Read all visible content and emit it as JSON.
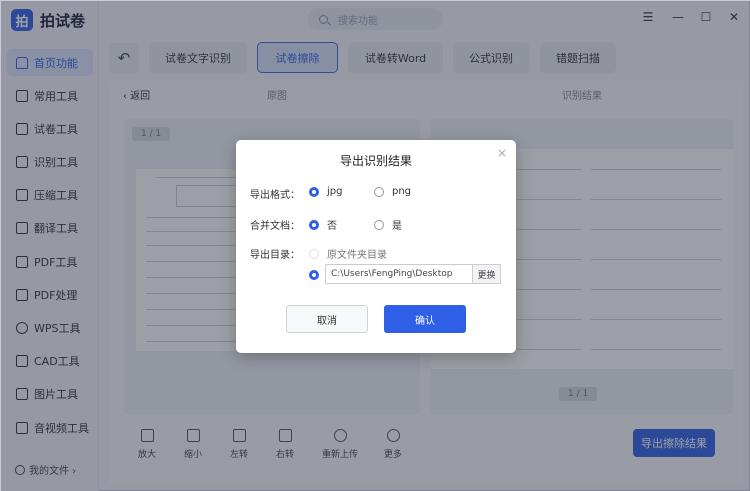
{
  "app": {
    "logo_mark": "拍",
    "name": "拍试卷"
  },
  "search": {
    "placeholder": "搜索功能"
  },
  "window_controls": {
    "menu": "☰",
    "minimize": "—",
    "maximize": "☐",
    "close": "✕"
  },
  "sidebar": {
    "items": [
      {
        "label": "首页功能",
        "icon": "home-icon",
        "active": true
      },
      {
        "label": "常用工具",
        "icon": "layers-icon",
        "active": false
      },
      {
        "label": "试卷工具",
        "icon": "paper-icon",
        "active": false
      },
      {
        "label": "识别工具",
        "icon": "scan-icon",
        "active": false
      },
      {
        "label": "压缩工具",
        "icon": "compress-icon",
        "active": false
      },
      {
        "label": "翻译工具",
        "icon": "translate-icon",
        "active": false
      },
      {
        "label": "PDF工具",
        "icon": "pdf-icon",
        "active": false
      },
      {
        "label": "PDF处理",
        "icon": "pdf-process-icon",
        "active": false
      },
      {
        "label": "WPS工具",
        "icon": "wps-icon",
        "active": false
      },
      {
        "label": "CAD工具",
        "icon": "cad-icon",
        "active": false
      },
      {
        "label": "图片工具",
        "icon": "image-icon",
        "active": false
      },
      {
        "label": "音视频工具",
        "icon": "video-icon",
        "active": false
      }
    ],
    "my_files": "我的文件 ›"
  },
  "toolbar": {
    "back_glyph": "↶",
    "tabs": [
      {
        "label": "试卷文字识别",
        "active": false
      },
      {
        "label": "试卷擦除",
        "active": true
      },
      {
        "label": "试卷转Word",
        "active": false
      },
      {
        "label": "公式识别",
        "active": false
      },
      {
        "label": "错题扫描",
        "active": false
      }
    ]
  },
  "content": {
    "return_label": "‹  返回",
    "original_label": "原图",
    "result_label": "识别结果",
    "left_page": "1 / 1",
    "right_page": "1 / 1"
  },
  "tools": [
    {
      "label": "放大",
      "icon": "zoom-in-icon"
    },
    {
      "label": "缩小",
      "icon": "zoom-out-icon"
    },
    {
      "label": "左转",
      "icon": "rotate-left-icon"
    },
    {
      "label": "右转",
      "icon": "rotate-right-icon"
    },
    {
      "label": "重新上传",
      "icon": "reupload-icon"
    },
    {
      "label": "更多",
      "icon": "more-icon"
    }
  ],
  "export_button": "导出擦除结果",
  "dialog": {
    "title": "导出识别结果",
    "close": "×",
    "format_label": "导出格式：",
    "format_options": [
      "jpg",
      "png"
    ],
    "format_selected": "jpg",
    "merge_label": "合并文档：",
    "merge_options": [
      "否",
      "是"
    ],
    "merge_selected": "否",
    "dir_label": "导出目录：",
    "dir_option_original": "原文件夹目录",
    "dir_path": "C:\\Users\\FengPing\\Desktop",
    "change_button": "更换",
    "cancel": "取消",
    "confirm": "确认"
  },
  "colors": {
    "accent": "#2e5fe6",
    "overlay": "rgba(40,45,60,0.45)"
  }
}
